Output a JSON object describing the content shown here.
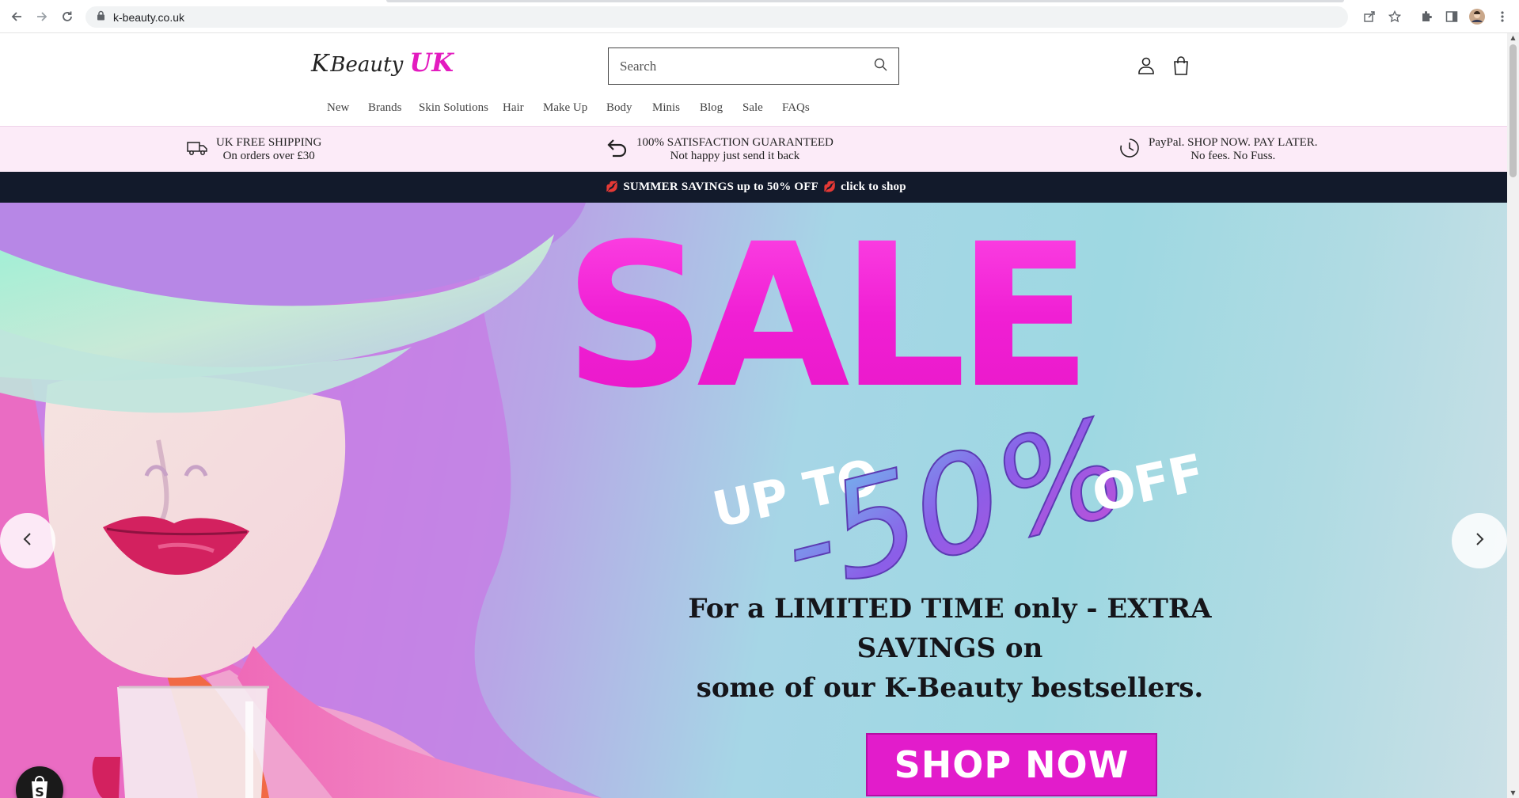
{
  "browser": {
    "url": "k-beauty.co.uk",
    "icons": [
      "back-icon",
      "forward-icon",
      "reload-icon",
      "lock-icon",
      "share-icon",
      "star-icon",
      "extensions-icon",
      "sidepanel-icon",
      "profile-avatar",
      "more-icon"
    ]
  },
  "header": {
    "logo": {
      "k": "K",
      "beauty": "Beauty",
      "uk": "UK"
    },
    "search_placeholder": "Search",
    "icons": [
      "search-icon",
      "account-icon",
      "cart-icon"
    ]
  },
  "menu": {
    "items": [
      "New",
      "Brands",
      "Skin Solutions",
      "Hair",
      "Make Up",
      "Body",
      "Minis",
      "Blog",
      "Sale",
      "FAQs"
    ]
  },
  "infobar": {
    "items": [
      {
        "line1": "UK FREE SHIPPING",
        "line2": "On orders over £30",
        "icon": "delivery-truck-icon"
      },
      {
        "line1": "100% SATISFACTION GUARANTEED",
        "line2": "Not happy just send it back",
        "icon": "return-arrow-icon"
      },
      {
        "line1": "PayPal. SHOP NOW. PAY LATER.",
        "line2": "No fees. No Fuss.",
        "icon": "clock-icon"
      }
    ]
  },
  "announcement": {
    "text": "SUMMER SAVINGS up to 50% OFF",
    "cta": "click to shop",
    "icon": "lips-icon"
  },
  "hero": {
    "sale": "SALE",
    "upto": "UP TO",
    "percent": "-50%",
    "off": "OFF",
    "text_line1": "For a LIMITED TIME only - EXTRA SAVINGS on",
    "text_line2": "some of our K-Beauty bestsellers.",
    "button": "SHOP NOW"
  },
  "colors": {
    "brand_pink": "#e21ccb",
    "announcement_bg": "#121a2b",
    "infobar_bg": "#fcebf8"
  }
}
